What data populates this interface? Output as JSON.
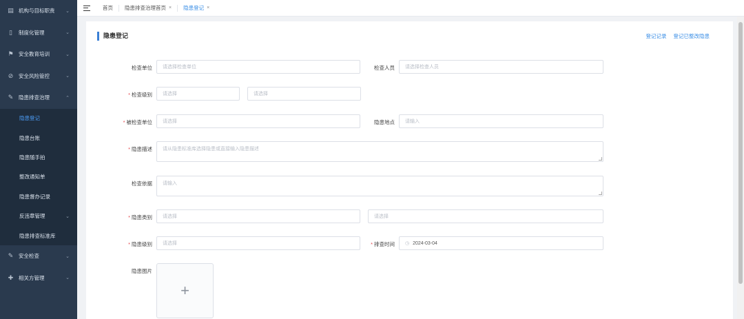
{
  "sidebar": {
    "items": [
      {
        "label": "机构与目标职责",
        "icon": "org-icon"
      },
      {
        "label": "制度化管理",
        "icon": "document-icon"
      },
      {
        "label": "安全教育培训",
        "icon": "flag-icon"
      },
      {
        "label": "安全风险管控",
        "icon": "shield-icon"
      },
      {
        "label": "隐患排查治理",
        "icon": "edit-icon"
      }
    ],
    "subitems": [
      {
        "label": "隐患登记",
        "active": true
      },
      {
        "label": "隐患台账"
      },
      {
        "label": "隐患随手拍"
      },
      {
        "label": "整改通知单"
      },
      {
        "label": "隐患督办记录"
      },
      {
        "label": "反违章管理"
      },
      {
        "label": "隐患排查标准库"
      }
    ],
    "bottom_items": [
      {
        "label": "安全检查",
        "icon": "edit-icon"
      },
      {
        "label": "相关方管理",
        "icon": "plus-icon"
      }
    ]
  },
  "tabs": {
    "home": "首页",
    "tab1": "隐患排查治理首页",
    "tab2": "隐患登记"
  },
  "card": {
    "title": "隐患登记",
    "link1": "登记记录",
    "link2": "登记已整改隐患"
  },
  "form": {
    "inspect_unit": {
      "label": "检查单位",
      "placeholder": "请选择检查单位"
    },
    "inspector": {
      "label": "检查人员",
      "placeholder": "请选择检查人员"
    },
    "inspect_level": {
      "label": "检查级别",
      "placeholder1": "请选择",
      "placeholder2": "请选择"
    },
    "inspected_unit": {
      "label": "被检查单位",
      "placeholder": "请选择"
    },
    "hazard_location": {
      "label": "隐患地点",
      "placeholder": "请输入"
    },
    "hazard_desc": {
      "label": "隐患描述",
      "placeholder": "请从隐患标准库选择隐患或直接输入隐患描述"
    },
    "basis": {
      "label": "检查依据",
      "placeholder": "请输入"
    },
    "hazard_type": {
      "label": "隐患类别",
      "placeholder1": "请选择",
      "placeholder2": "请选择"
    },
    "hazard_level": {
      "label": "隐患级别",
      "placeholder": "请选择"
    },
    "check_time": {
      "label": "排查时间",
      "value": "2024-03-04"
    },
    "photos": {
      "label": "隐患图片",
      "upload_symbol": "+"
    }
  }
}
